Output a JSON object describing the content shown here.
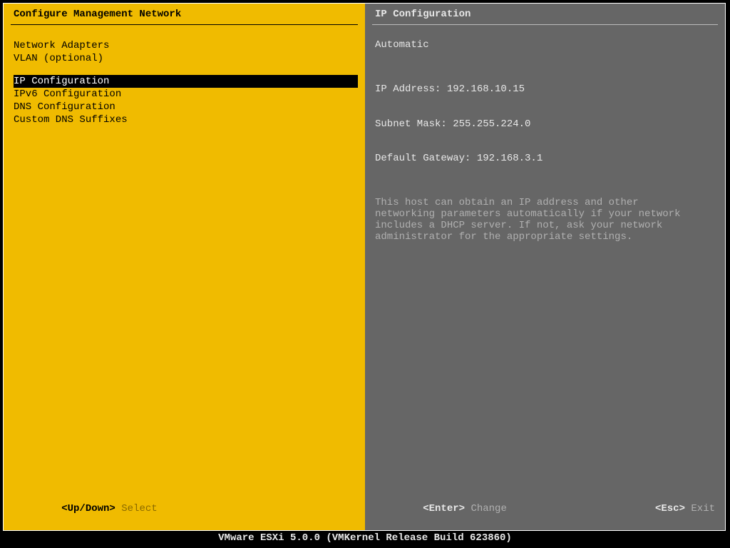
{
  "left": {
    "title": "Configure Management Network",
    "group1": [
      {
        "label": "Network Adapters"
      },
      {
        "label": "VLAN (optional)"
      }
    ],
    "group2": [
      {
        "label": "IP Configuration",
        "selected": true
      },
      {
        "label": "IPv6 Configuration"
      },
      {
        "label": "DNS Configuration"
      },
      {
        "label": "Custom DNS Suffixes"
      }
    ],
    "footer_key": "<Up/Down>",
    "footer_action": "Select"
  },
  "right": {
    "title": "IP Configuration",
    "mode": "Automatic",
    "lines": {
      "ip": "IP Address: 192.168.10.15",
      "mask": "Subnet Mask: 255.255.224.0",
      "gateway": "Default Gateway: 192.168.3.1"
    },
    "help": "This host can obtain an IP address and other networking parameters automatically if your network includes a DHCP server. If not, ask your network administrator for the appropriate settings.",
    "footer_a_key": "<Enter>",
    "footer_a_action": "Change",
    "footer_b_key": "<Esc>",
    "footer_b_action": "Exit"
  },
  "status": "VMware ESXi 5.0.0 (VMKernel Release Build 623860)"
}
